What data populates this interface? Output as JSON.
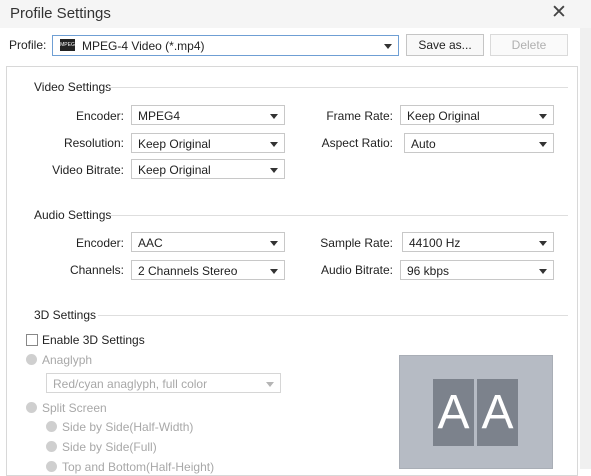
{
  "window": {
    "title": "Profile Settings"
  },
  "profile": {
    "label": "Profile:",
    "value": "MPEG-4 Video (*.mp4)",
    "icon_text": "MPEG",
    "save_as": "Save as...",
    "delete": "Delete"
  },
  "video": {
    "title": "Video Settings",
    "encoder_label": "Encoder:",
    "encoder_value": "MPEG4",
    "resolution_label": "Resolution:",
    "resolution_value": "Keep Original",
    "bitrate_label": "Video Bitrate:",
    "bitrate_value": "Keep Original",
    "framerate_label": "Frame Rate:",
    "framerate_value": "Keep Original",
    "aspect_label": "Aspect Ratio:",
    "aspect_value": "Auto"
  },
  "audio": {
    "title": "Audio Settings",
    "encoder_label": "Encoder:",
    "encoder_value": "AAC",
    "channels_label": "Channels:",
    "channels_value": "2 Channels Stereo",
    "samplerate_label": "Sample Rate:",
    "samplerate_value": "44100 Hz",
    "bitrate_label": "Audio Bitrate:",
    "bitrate_value": "96 kbps"
  },
  "threed": {
    "title": "3D Settings",
    "enable_label": "Enable 3D Settings",
    "anaglyph_label": "Anaglyph",
    "anaglyph_value": "Red/cyan anaglyph, full color",
    "split_label": "Split Screen",
    "sbs_half": "Side by Side(Half-Width)",
    "sbs_full": "Side by Side(Full)",
    "tb_half": "Top and Bottom(Half-Height)",
    "preview_left": "A",
    "preview_right": "A"
  },
  "colors": {
    "preview_bg": "#b6bbc4",
    "preview_tile": "#7c828c",
    "disabled_text": "#a8a8a8"
  }
}
